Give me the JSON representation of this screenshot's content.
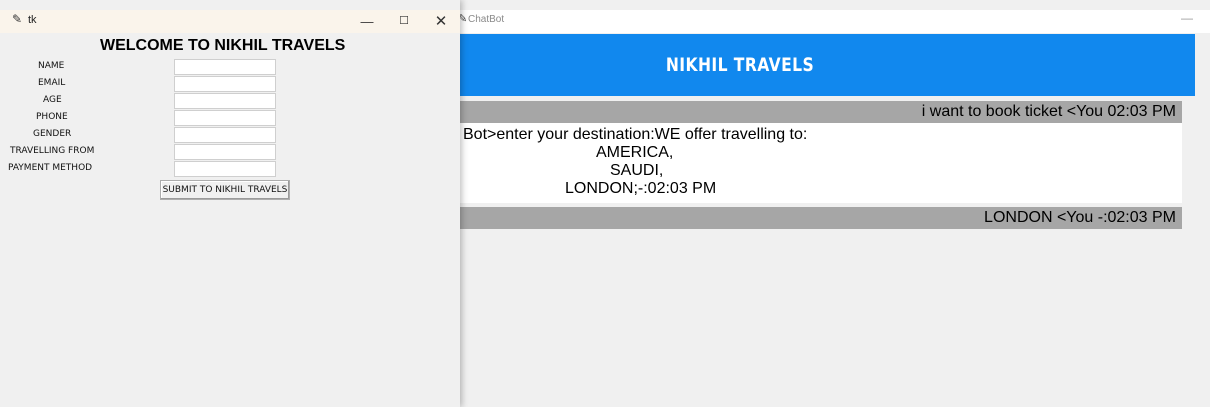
{
  "chat_window": {
    "title": "ChatBot",
    "icon": "feather-icon",
    "minimize_glyph": "—",
    "banner_title": "NIKHIL TRAVELS",
    "banner_color": "#1188ee",
    "messages": [
      {
        "sender": "user",
        "text": "i want to book ticket <You  02:03 PM"
      },
      {
        "sender": "bot",
        "lines": [
          "Bot>enter your destination:WE offer travelling to:",
          "AMERICA,",
          "SAUDI,",
          "LONDON;-:02:03 PM"
        ]
      },
      {
        "sender": "user",
        "text": "LONDON <You  -:02:03 PM"
      }
    ]
  },
  "tk_window": {
    "title": "tk",
    "icon": "feather-icon",
    "controls": {
      "minimize": "—",
      "maximize": "☐",
      "close": "✕"
    },
    "form": {
      "heading": "WELCOME TO NIKHIL TRAVELS",
      "fields": [
        {
          "label": "NAME",
          "value": ""
        },
        {
          "label": "EMAIL",
          "value": ""
        },
        {
          "label": "AGE",
          "value": ""
        },
        {
          "label": "PHONE",
          "value": ""
        },
        {
          "label": "GENDER",
          "value": ""
        },
        {
          "label": "TRAVELLING FROM",
          "value": ""
        },
        {
          "label": "PAYMENT METHOD",
          "value": ""
        }
      ],
      "submit_label": "SUBMIT TO NIKHIL TRAVELS"
    }
  }
}
